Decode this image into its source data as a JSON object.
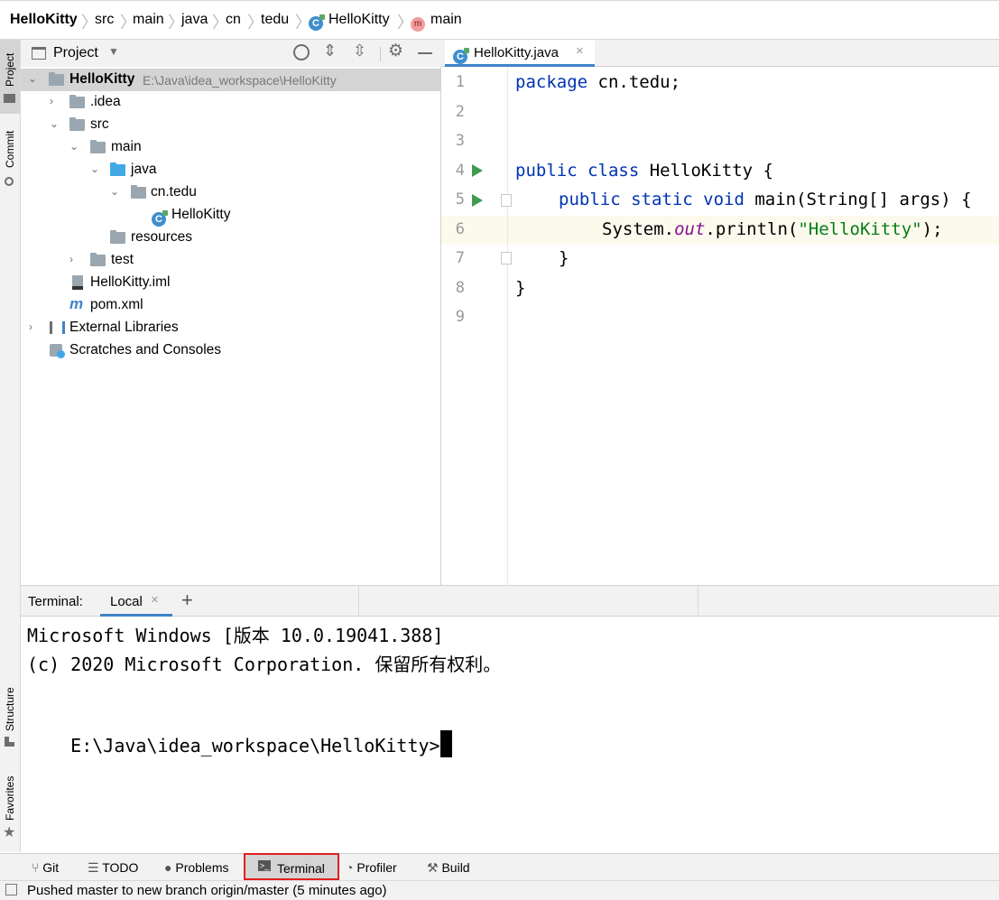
{
  "breadcrumb": {
    "project": "HelloKitty",
    "items": [
      "src",
      "main",
      "java",
      "cn",
      "tedu",
      "HelloKitty",
      "main"
    ]
  },
  "left_strip": {
    "project_tab": "Project",
    "commit_tab": "Commit",
    "structure_tab": "Structure",
    "favorites_tab": "Favorites"
  },
  "project_panel": {
    "title": "Project",
    "tree": {
      "root_name": "HelloKitty",
      "root_path": "E:\\Java\\idea_workspace\\HelloKitty",
      "idea": ".idea",
      "src": "src",
      "main": "main",
      "java": "java",
      "package": "cn.tedu",
      "class": "HelloKitty",
      "resources": "resources",
      "test": "test",
      "iml": "HelloKitty.iml",
      "pom": "pom.xml",
      "ext_libs": "External Libraries",
      "scratches": "Scratches and Consoles"
    }
  },
  "editor": {
    "tab_label": "HelloKitty.java",
    "line_numbers": [
      "1",
      "2",
      "3",
      "4",
      "5",
      "6",
      "7",
      "8",
      "9"
    ],
    "code": {
      "l1_kw": "package",
      "l1_rest": " cn.tedu;",
      "l4_kw": "public class",
      "l4_rest": " HelloKitty {",
      "l5_kw": "public static void",
      "l5_rest": " main(String[] args) {",
      "l6_a": "System.",
      "l6_field": "out",
      "l6_b": ".println(",
      "l6_str": "\"HelloKitty\"",
      "l6_c": ");",
      "l7": "}",
      "l8": "}"
    }
  },
  "terminal": {
    "label": "Terminal:",
    "tab": "Local",
    "add": "+",
    "lines": [
      "Microsoft Windows [版本 10.0.19041.388]",
      "(c) 2020 Microsoft Corporation. 保留所有权利。",
      "E:\\Java\\idea_workspace\\HelloKitty>"
    ]
  },
  "bottom_tools": {
    "git": "Git",
    "todo": "TODO",
    "problems": "Problems",
    "terminal": "Terminal",
    "profiler": "Profiler",
    "build": "Build"
  },
  "status": {
    "message": "Pushed master to new branch origin/master (5 minutes ago)"
  },
  "colors": {
    "accent_blue": "#4083c9",
    "run_green": "#3e9b4f",
    "highlight_box": "#e02020",
    "current_line": "#fcfaed"
  }
}
